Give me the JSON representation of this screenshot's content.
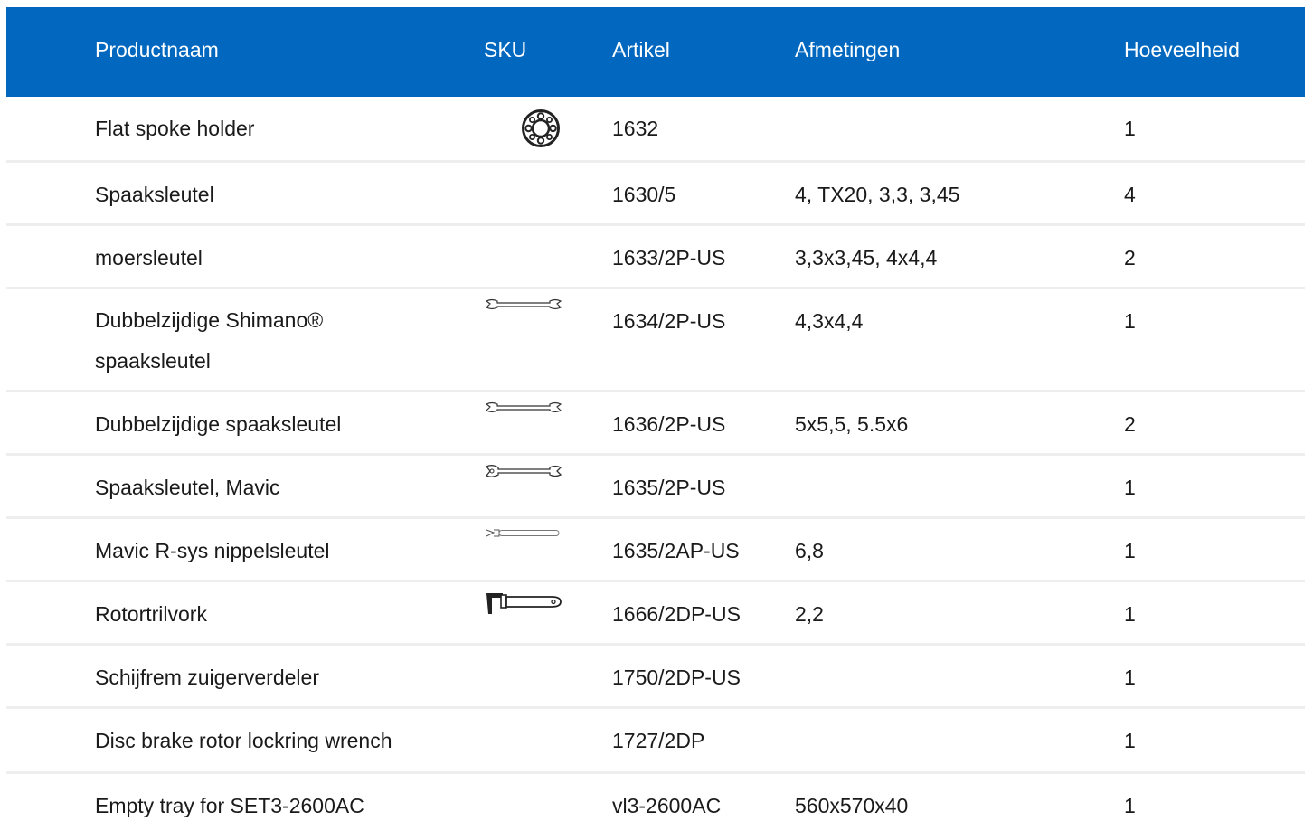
{
  "table": {
    "headers": {
      "name": "Productnaam",
      "sku": "SKU",
      "artikel": "Artikel",
      "afmetingen": "Afmetingen",
      "hoeveelheid": "Hoeveelheid"
    },
    "rows": [
      {
        "name": "Flat spoke holder",
        "sku_icon": "spoke-holder-ring-icon",
        "artikel": "1632",
        "afmetingen": "",
        "hoeveelheid": "1"
      },
      {
        "name": "Spaaksleutel",
        "sku_icon": "",
        "artikel": "1630/5",
        "afmetingen": "4, TX20, 3,3, 3,45",
        "hoeveelheid": "4"
      },
      {
        "name": "moersleutel",
        "sku_icon": "",
        "artikel": "1633/2P-US",
        "afmetingen": "3,3x3,45, 4x4,4",
        "hoeveelheid": "2"
      },
      {
        "name": "Dubbelzijdige Shimano® spaaksleutel",
        "sku_icon": "double-ended-wrench-icon",
        "artikel": "1634/2P-US",
        "afmetingen": "4,3x4,4",
        "hoeveelheid": "1"
      },
      {
        "name": "Dubbelzijdige spaaksleutel",
        "sku_icon": "double-ended-wrench-icon",
        "artikel": "1636/2P-US",
        "afmetingen": "5x5,5, 5.5x6",
        "hoeveelheid": "2"
      },
      {
        "name": "Spaaksleutel, Mavic",
        "sku_icon": "double-ended-wrench-icon",
        "artikel": "1635/2P-US",
        "afmetingen": "",
        "hoeveelheid": "1"
      },
      {
        "name": "Mavic R-sys nippelsleutel",
        "sku_icon": "nipple-wrench-icon",
        "artikel": "1635/2AP-US",
        "afmetingen": "6,8",
        "hoeveelheid": "1"
      },
      {
        "name": "Rotortrilvork",
        "sku_icon": "rotor-truing-fork-icon",
        "artikel": "1666/2DP-US",
        "afmetingen": "2,2",
        "hoeveelheid": "1"
      },
      {
        "name": "Schijfrem zuigerverdeler",
        "sku_icon": "",
        "artikel": "1750/2DP-US",
        "afmetingen": "",
        "hoeveelheid": "1"
      },
      {
        "name": "Disc brake rotor lockring wrench",
        "sku_icon": "",
        "artikel": "1727/2DP",
        "afmetingen": "",
        "hoeveelheid": "1"
      },
      {
        "name": "Empty tray for SET3-2600AC",
        "sku_icon": "",
        "artikel": "vl3-2600AC",
        "afmetingen": "560x570x40",
        "hoeveelheid": "1"
      }
    ]
  },
  "colors": {
    "header_bg": "#0167bf",
    "header_text": "#ffffff",
    "row_divider": "#eeeeee",
    "body_text": "#1a1a1a"
  }
}
